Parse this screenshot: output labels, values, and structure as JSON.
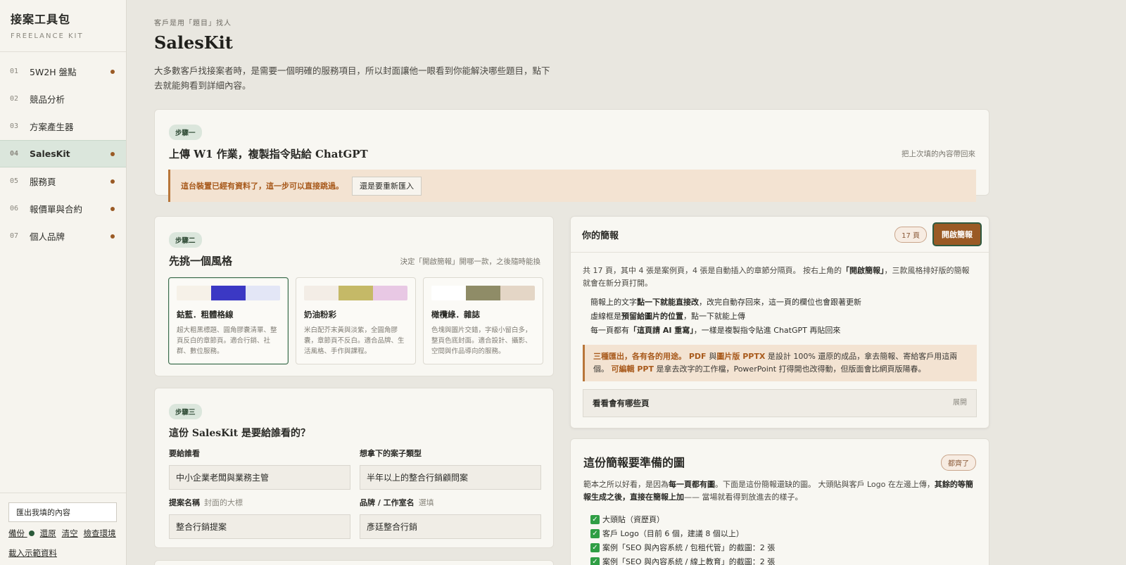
{
  "sidebar": {
    "brand_title": "接案工具包",
    "brand_sub": "FREELANCE KIT",
    "items": [
      {
        "num": "01",
        "label": "5W2H 盤點",
        "dot": true
      },
      {
        "num": "02",
        "label": "競品分析",
        "dot": false
      },
      {
        "num": "03",
        "label": "方案產生器",
        "dot": false
      },
      {
        "num": "04",
        "label": "SalesKit",
        "dot": true
      },
      {
        "num": "05",
        "label": "服務頁",
        "dot": true
      },
      {
        "num": "06",
        "label": "報價單與合約",
        "dot": true
      },
      {
        "num": "07",
        "label": "個人品牌",
        "dot": true
      }
    ],
    "export_label": "匯出我填的內容",
    "links": {
      "backup": "備份",
      "restore": "還原",
      "clear": "清空",
      "check_env": "檢查環境",
      "load_demo": "載入示範資料"
    }
  },
  "header": {
    "eyebrow": "客戶是用「題目」找人",
    "title": "SalesKit",
    "intro": "大多數客戶找接案者時，是需要一個明確的服務項目，所以封面讓他一眼看到你能解決哪些題目，點下去就能夠看到詳細內容。"
  },
  "step1": {
    "pill": "步驟一",
    "title": "上傳 W1 作業，複製指令貼給 ChatGPT",
    "hint": "把上次填的內容帶回來",
    "notice": "這台裝置已經有資料了，這一步可以直接跳過。",
    "reimport_label": "還是要重新匯入"
  },
  "step2": {
    "pill": "步驟二",
    "title": "先挑一個風格",
    "hint": "決定「開啟簡報」開哪一款，之後隨時能換",
    "styles": [
      {
        "name": "鈷藍．粗體格線",
        "desc": "超大粗黑標題、圓角膠囊清單、整頁反白的章節頁。適合行銷、社群、數位服務。",
        "colors": [
          "#f6f1e8",
          "#3b38c4",
          "#e3e6f6"
        ]
      },
      {
        "name": "奶油粉彩",
        "desc": "米白配芥末黃與淡紫，全圓角膠囊，章節頁不反白。適合品牌、生活風格、手作與課程。",
        "colors": [
          "#f3ede6",
          "#c5b967",
          "#e8c8e4"
        ]
      },
      {
        "name": "橄欖綠．雜誌",
        "desc": "色塊與圖片交錯，字級小留白多，整頁色底封面。適合設計、攝影、空間與作品導向的服務。",
        "colors": [
          "#ffffff",
          "#8f8c67",
          "#e4d6c6"
        ]
      }
    ]
  },
  "step3": {
    "pill": "步驟三",
    "title": "這份 SalesKit 是要給誰看的？",
    "audience_label": "要給誰看",
    "audience_value": "中小企業老闆與業務主管",
    "case_type_label": "想拿下的案子類型",
    "case_type_value": "半年以上的整合行銷顧問案",
    "proposal_label": "提案名稱",
    "proposal_sub": "封面的大標",
    "proposal_value": "整合行銷提案",
    "brand_label": "品牌 / 工作室名",
    "brand_sub": "選填",
    "brand_value": "彥廷整合行銷"
  },
  "deck": {
    "title": "你的簡報",
    "pages_badge": "17 頁",
    "open_label": "開啟簡報",
    "summary_a": "共 17 頁，其中 4 張是案例頁，4 張是自動插入的章節分隔頁。 按右上角的",
    "summary_b": "「開啟簡報」",
    "summary_c": "，三款風格排好版的簡報就會在新分頁打開。",
    "bullet1_a": "簡報上的文字",
    "bullet1_b": "點一下就能直接改",
    "bullet1_c": "，改完自動存回來，這一頁的欄位也會跟著更新",
    "bullet2_a": "虛線框是",
    "bullet2_b": "預留給圖片的位置",
    "bullet2_c": "，點一下就能上傳",
    "bullet3_a": "每一頁都有",
    "bullet3_b": "「這頁請 AI 重寫」",
    "bullet3_c": "，一樣是複製指令貼進 ChatGPT 再貼回來",
    "warn_a": "三種匯出，各有各的用途。",
    "warn_b": " PDF ",
    "warn_c": "與",
    "warn_d": "圖片版 PPTX",
    "warn_e": " 是設計 100% 還原的成品，拿去簡報、寄給客戶用這兩個。 ",
    "warn_f": "可編輯 PPT",
    "warn_g": " 是拿去改字的工作檔，PowerPoint 打得開也改得動，但版面會比網頁版陽春。",
    "expand_label": "看看會有哪些頁",
    "expand_hint": "展開"
  },
  "images": {
    "title": "這份簡報要準備的圖",
    "badge": "都齊了",
    "desc_a": "範本之所以好看，是因為",
    "desc_b": "每一頁都有圖",
    "desc_c": "。下面是這份簡報還缺的圖。 大頭貼與客戶 Logo 在左邊上傳，",
    "desc_d": "其餘的等簡報生成之後，直接在簡報上加",
    "desc_e": "—— 當場就看得到放進去的樣子。",
    "checklist": [
      "大頭貼（資歷頁）",
      "客戶 Logo（目前 6 個，建議 8 個以上）",
      "案例「SEO 與內容系統 / 包租代管」的截圖：2 張",
      "案例「SEO 與內容系統 / 線上教育」的截圖：2 張"
    ]
  }
}
